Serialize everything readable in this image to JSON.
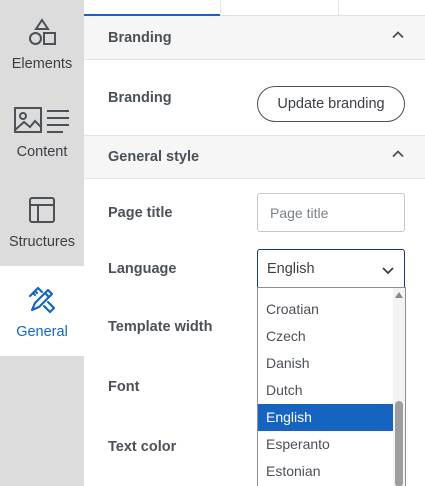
{
  "rail": {
    "items": [
      {
        "label": "Elements"
      },
      {
        "label": "Content"
      },
      {
        "label": "Structures"
      },
      {
        "label": "General"
      }
    ]
  },
  "sections": {
    "branding": {
      "title": "Branding",
      "row_label": "Branding",
      "button_label": "Update branding"
    },
    "general_style": {
      "title": "General style",
      "page_title_label": "Page title",
      "page_title_placeholder": "Page title",
      "language_label": "Language",
      "language_value": "English",
      "template_width_label": "Template width",
      "font_label": "Font",
      "text_color_label": "Text color"
    }
  },
  "language_dropdown": {
    "options": [
      "Croatian",
      "Czech",
      "Danish",
      "Dutch",
      "English",
      "Esperanto",
      "Estonian"
    ],
    "selected": "English"
  },
  "colors": {
    "accent": "#1565c0",
    "rail_bg": "#dcdcdc",
    "section_header_bg": "#f6f6f6"
  }
}
